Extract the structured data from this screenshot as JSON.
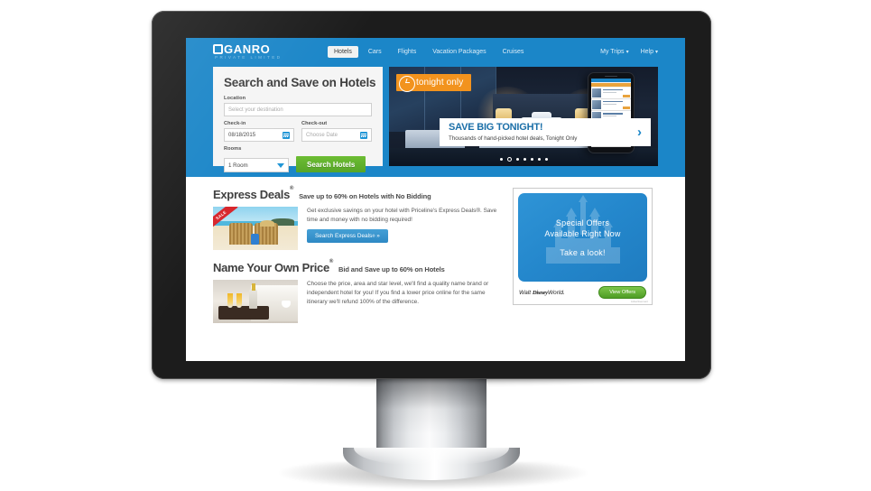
{
  "brand": {
    "logo_text": "GANRO",
    "logo_tagline": "Private Limited",
    "logo_mark": "square-o-icon"
  },
  "nav": {
    "items": [
      {
        "label": "Hotels",
        "active": true
      },
      {
        "label": "Cars",
        "active": false
      },
      {
        "label": "Flights",
        "active": false
      },
      {
        "label": "Vacation Packages",
        "active": false
      },
      {
        "label": "Cruises",
        "active": false
      }
    ],
    "right_items": [
      {
        "label": "My Trips",
        "caret": "▾"
      },
      {
        "label": "Help",
        "caret": "▾"
      }
    ]
  },
  "search_panel": {
    "title": "Search and Save on Hotels",
    "location_label": "Location",
    "location_placeholder": "Select your destination",
    "location_value": "",
    "checkin_label": "Check-in",
    "checkin_value": "08/18/2015",
    "checkout_label": "Check-out",
    "checkout_placeholder": "Choose Date",
    "rooms_label": "Rooms",
    "rooms_value": "1 Room",
    "submit_label": "Search Hotels"
  },
  "hero": {
    "badge_label": "tonight only",
    "badge_icon": "clock-icon",
    "title": "SAVE BIG TONIGHT!",
    "subtitle": "Thousands of hand-picked hotel deals, Tonight Only",
    "next_arrow": "›",
    "dots_total": 7,
    "dots_active_index": 1,
    "accent_orange": "#f2931e",
    "accent_blue": "#1b86c8"
  },
  "express_deals": {
    "title": "Express Deals",
    "title_mark": "®",
    "subtitle": "Save up to 60% on Hotels with No Bidding",
    "body": "Get exclusive savings on your hotel with Priceline's Express Deals®. Save time and money with no bidding required!",
    "button_label": "Search Express Deals",
    "button_mark": "®",
    "button_arrow": "»",
    "thumb_badge": "SALE",
    "thumb_alt": "beach-chairs-photo"
  },
  "name_your_own_price": {
    "title": "Name Your Own Price",
    "title_mark": "®",
    "subtitle": "Bid and Save up to 60% on Hotels",
    "body": "Choose the price, area and star level, we'll find a quality name brand or independent hotel for you! If you find a lower price online for the same itinerary we'll refund 100% of the difference.",
    "thumb_alt": "champagne-hotel-room-photo"
  },
  "ad": {
    "line1": "Special Offers",
    "line2": "Available Right Now",
    "line3": "Take a look!",
    "advertiser": "Walt Disney World.",
    "advertiser_prefix": "Walt",
    "advertiser_mid": "Disney",
    "advertiser_suffix": "World.",
    "button_label": "View Offers",
    "credit": "Advertisement"
  }
}
